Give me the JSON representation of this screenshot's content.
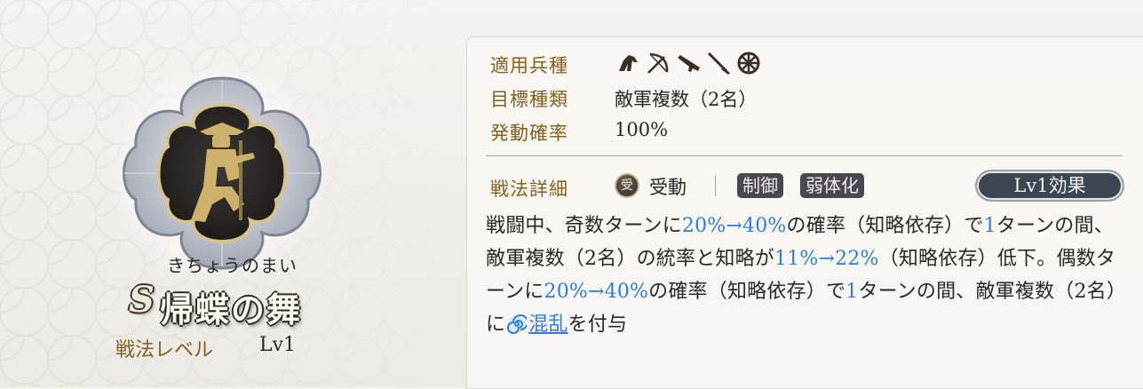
{
  "skill": {
    "furigana": "きちょうのまい",
    "rank": "S",
    "name": "帰蝶の舞",
    "level_label": "戦法レベル",
    "level_value": "Lv1"
  },
  "panel": {
    "unit_types_label": "適用兵種",
    "unit_types": [
      "cavalry-icon",
      "bow-icon",
      "gun-icon",
      "spear-icon",
      "siege-wheel-icon"
    ],
    "target_label": "目標種類",
    "target_value": "敵軍複数（2名）",
    "rate_label": "発動確率",
    "rate_value": "100%",
    "detail_label": "戦法詳細",
    "passive_badge": "受",
    "passive_label": "受動",
    "tags": [
      "制御",
      "弱体化"
    ],
    "level_effect_button": "Lv1効果"
  },
  "description": {
    "p1": "戦闘中、奇数ターンに",
    "v1": "20%→40%",
    "p2": "の確率（知略依存）で",
    "v2": "1",
    "p3": "ターンの間、敵軍複数（2名）の統率と知略が",
    "v3": "11%→22%",
    "p4": "（知略依存）低下。偶数ターンに",
    "v4": "20%→40%",
    "p5": "の確率（知略依存）で",
    "v5": "1",
    "p6": "ターンの間、敵軍複数（2名）に",
    "status": "混乱",
    "p7": "を付与"
  },
  "colors": {
    "label_gold": "#86601e",
    "value_blue": "#2f7ddb",
    "tag_bg": "#4c4653",
    "button_bg": "#3c4652"
  }
}
